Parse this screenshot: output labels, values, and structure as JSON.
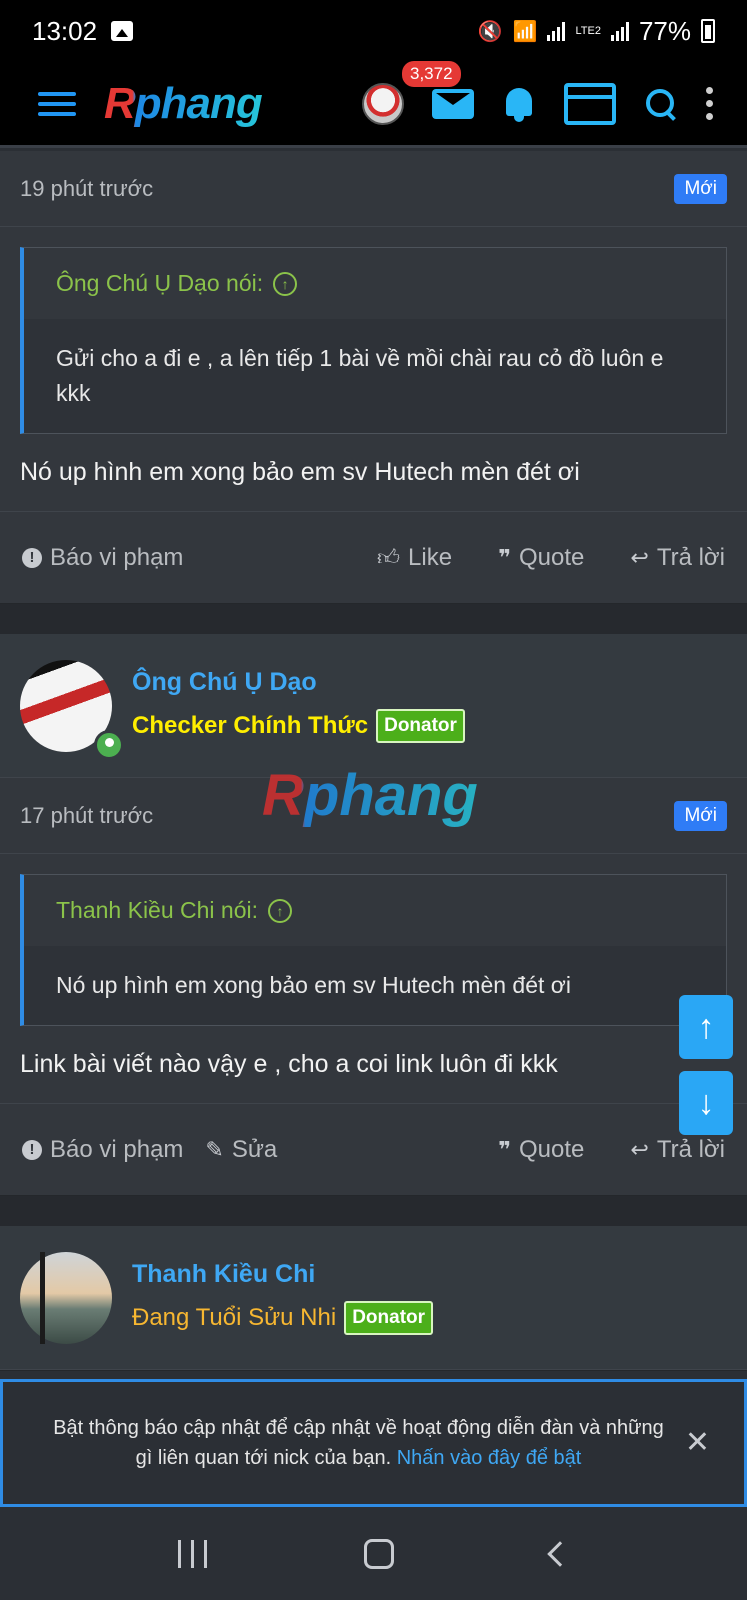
{
  "status_bar": {
    "time": "13:02",
    "battery": "77%",
    "network": "LTE2"
  },
  "header": {
    "logo": "Rphang",
    "mail_badge": "3,372"
  },
  "posts": [
    {
      "time": "19 phút trước",
      "new_badge": "Mới",
      "quote_author": "Ông Chú Ụ Dạo nói:",
      "quote_text": "Gửi cho a đi e , a lên tiếp 1 bài về mồi chài rau cỏ đồ luôn e kkk",
      "text": "Nó up hình em xong bảo em sv Hutech mèn đét ơi",
      "actions": {
        "report": "Báo vi phạm",
        "like": "Like",
        "quote": "Quote",
        "reply": "Trả lời"
      }
    },
    {
      "user": {
        "name": "Ông Chú Ụ Dạo",
        "title": "Checker Chính Thức",
        "badge": "Donator"
      },
      "time": "17 phút trước",
      "new_badge": "Mới",
      "quote_author": "Thanh Kiều Chi nói:",
      "quote_text": "Nó up hình em xong bảo em sv Hutech mèn đét ơi",
      "text": "Link bài viết nào vậy e , cho a coi link luôn đi kkk",
      "actions": {
        "report": "Báo vi phạm",
        "edit": "Sửa",
        "quote": "Quote",
        "reply": "Trả lời"
      }
    },
    {
      "user": {
        "name": "Thanh Kiều Chi",
        "title": "Đang Tuổi Sửu Nhi",
        "badge": "Donator"
      }
    }
  ],
  "watermark": "Rphang",
  "notification": {
    "text": "Bật thông báo cập nhật để cập nhật về hoạt động diễn đàn và những gì liên quan tới nick của bạn.",
    "link": "Nhấn vào đây để bật",
    "close": "✕"
  },
  "icons": {
    "scroll_up": "↑",
    "scroll_down": "↓",
    "quote_arrow": "↑"
  }
}
